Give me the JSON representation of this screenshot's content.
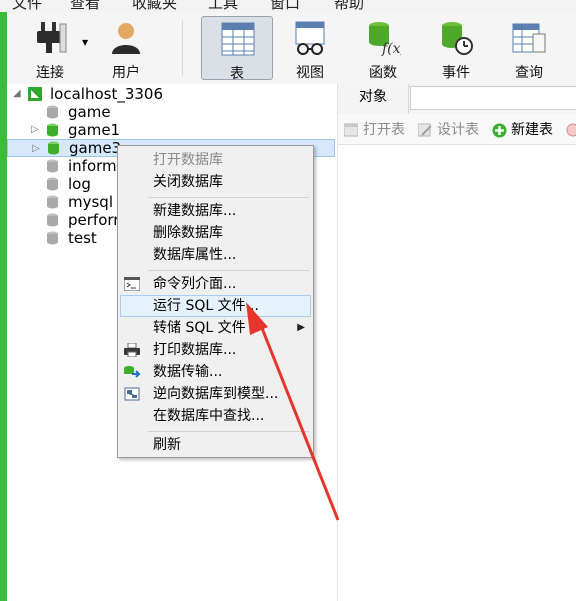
{
  "menubar": {
    "items": [
      "文件",
      "查看",
      "收藏夹",
      "工具",
      "窗口",
      "帮助"
    ]
  },
  "toolbar": {
    "buttons": [
      {
        "label": "连接",
        "icon": "plug-icon"
      },
      {
        "label": "用户",
        "icon": "user-icon"
      },
      {
        "label": "表",
        "icon": "table-icon",
        "active": true
      },
      {
        "label": "视图",
        "icon": "view-icon"
      },
      {
        "label": "函数",
        "icon": "function-icon"
      },
      {
        "label": "事件",
        "icon": "event-icon"
      },
      {
        "label": "查询",
        "icon": "query-icon"
      }
    ]
  },
  "tree": {
    "connection": "localhost_3306",
    "databases": [
      "game",
      "game1",
      "game3",
      "inform",
      "log",
      "mysql",
      "perforr",
      "test"
    ],
    "selected": "game3"
  },
  "right_panel": {
    "tab": "对象",
    "object_toolbar": [
      {
        "label": "打开表",
        "disabled": true
      },
      {
        "label": "设计表",
        "disabled": true
      },
      {
        "label": "新建表",
        "disabled": false
      }
    ]
  },
  "context_menu": {
    "items": [
      {
        "label": "打开数据库",
        "disabled": true
      },
      {
        "label": "关闭数据库"
      },
      {
        "label": "新建数据库..."
      },
      {
        "label": "删除数据库"
      },
      {
        "label": "数据库属性..."
      },
      {
        "label": "命令列介面...",
        "icon": "console-icon"
      },
      {
        "label": "运行 SQL 文件...",
        "highlighted": true
      },
      {
        "label": "转储 SQL 文件",
        "submenu": true
      },
      {
        "label": "打印数据库...",
        "icon": "printer-icon"
      },
      {
        "label": "数据传输...",
        "icon": "transfer-icon"
      },
      {
        "label": "逆向数据库到模型...",
        "icon": "model-icon"
      },
      {
        "label": "在数据库中查找..."
      },
      {
        "label": "刷新"
      }
    ]
  },
  "colors": {
    "accent_green": "#3dbb3d",
    "selection": "#d6e8fb",
    "annotation_red": "#e8352b"
  }
}
